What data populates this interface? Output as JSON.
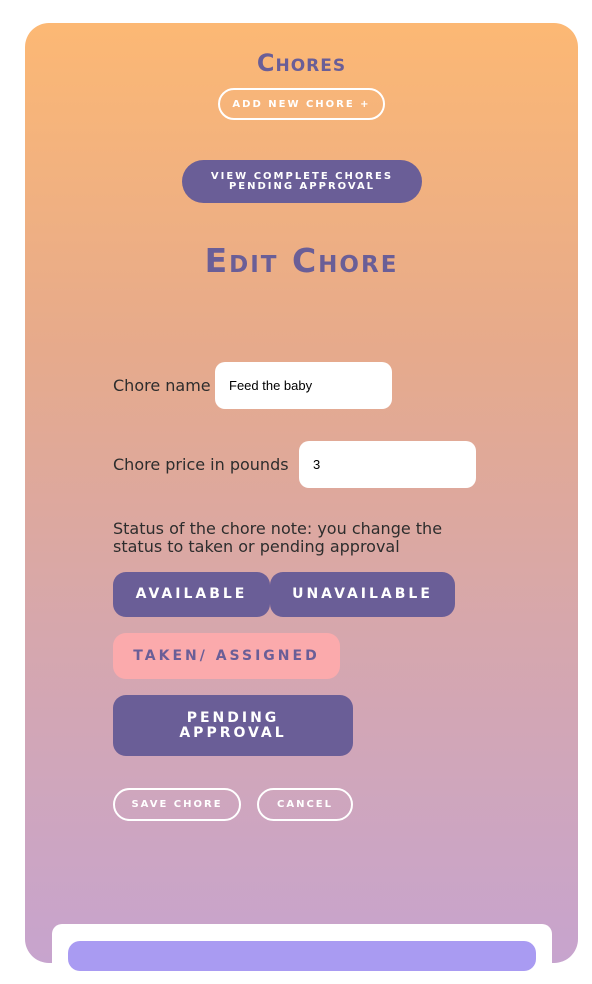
{
  "page": {
    "title": "Chores",
    "add_button": "ADD NEW CHORE +",
    "view_button": "VIEW COMPLETE CHORES PENDING APPROVAL",
    "edit_heading": "Edit Chore"
  },
  "form": {
    "name_label": "Chore name",
    "name_value": "Feed the baby",
    "price_label": "Chore price in pounds",
    "price_value": "3",
    "status_label": "Status of the chore note: you change the status to taken or pending approval"
  },
  "status_options": {
    "available": "AVAILABLE",
    "unavailable": "UNAVAILABLE",
    "taken": "TAKEN/ ASSIGNED",
    "pending": "PENDING APPROVAL"
  },
  "actions": {
    "save": "SAVE CHORE",
    "cancel": "CANCEL"
  },
  "colors": {
    "accent": "#6a5e97",
    "taken_bg": "#fbaaac",
    "gradient_top": "#fcb874",
    "gradient_bottom": "#c7a4ce",
    "bottom_bar": "#a99bf2"
  }
}
